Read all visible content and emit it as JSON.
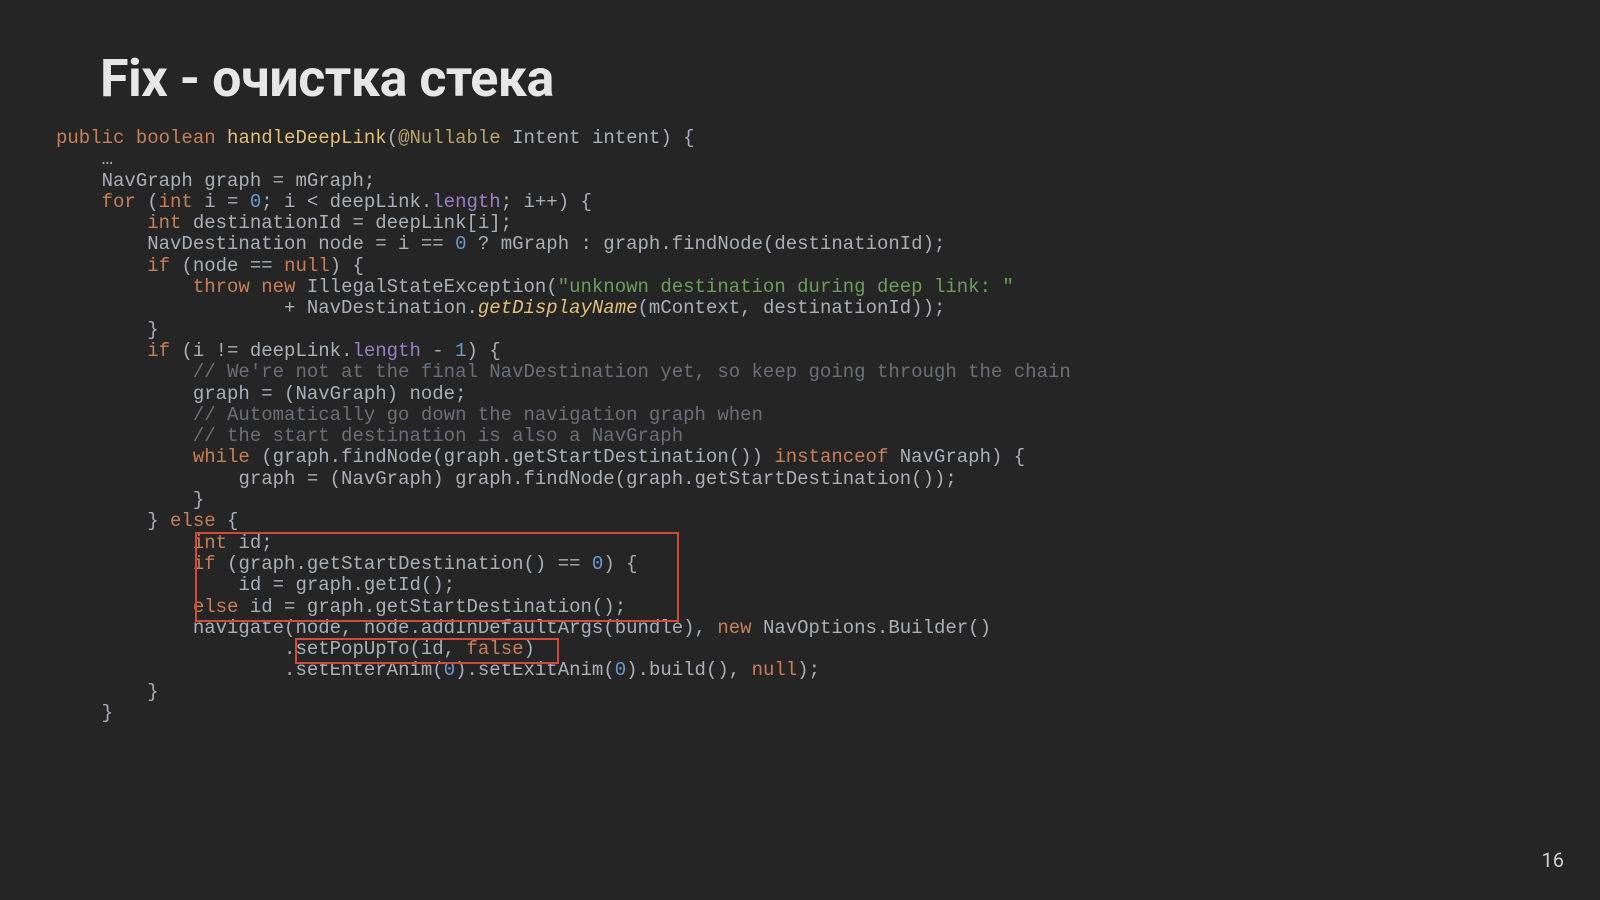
{
  "title": "Fix - очистка стека",
  "page_number": "16",
  "code": {
    "l0": {
      "indent": "",
      "a": "public ",
      "b": "boolean ",
      "c": "handleDeepLink",
      "d": "(",
      "e": "@Nullable ",
      "f": "Intent intent) {"
    },
    "l1": {
      "indent": "    ",
      "a": "…"
    },
    "l2": {
      "indent": "    ",
      "a": "NavGraph graph = mGraph;"
    },
    "l3": {
      "indent": "    ",
      "a": "for ",
      "b": "(",
      "c": "int ",
      "d": "i = ",
      "e": "0",
      "f": "; i < deepLink.",
      "g": "length",
      "h": "; i++) {"
    },
    "l4": {
      "indent": "        ",
      "a": "int ",
      "b": "destinationId = deepLink[i];"
    },
    "l5": {
      "indent": "        ",
      "a": "NavDestination node = i == ",
      "b": "0 ",
      "c": "? mGraph : graph.findNode(destinationId);"
    },
    "l6": {
      "indent": "        ",
      "a": "if ",
      "b": "(node == ",
      "c": "null",
      "d": ") {"
    },
    "l7": {
      "indent": "            ",
      "a": "throw new ",
      "b": "IllegalStateException(",
      "c": "\"unknown destination during deep link: \""
    },
    "l8": {
      "indent": "                    ",
      "a": "+ NavDestination.",
      "b": "getDisplayName",
      "c": "(mContext, destinationId));"
    },
    "l9": {
      "indent": "        ",
      "a": "}"
    },
    "l10": {
      "indent": "        ",
      "a": "if ",
      "b": "(i != deepLink.",
      "c": "length ",
      "d": "- ",
      "e": "1",
      "f": ") {"
    },
    "l11": {
      "indent": "            ",
      "a": "// We're not at the final NavDestination yet, so keep going through the chain"
    },
    "l12": {
      "indent": "            ",
      "a": "graph = (NavGraph) node;"
    },
    "l13": {
      "indent": "            ",
      "a": "// Automatically go down the navigation graph when"
    },
    "l14": {
      "indent": "            ",
      "a": "// the start destination is also a NavGraph"
    },
    "l15": {
      "indent": "            ",
      "a": "while ",
      "b": "(graph.findNode(graph.getStartDestination()) ",
      "c": "instanceof ",
      "d": "NavGraph) {"
    },
    "l16": {
      "indent": "                ",
      "a": "graph = (NavGraph) graph.findNode(graph.getStartDestination());"
    },
    "l17": {
      "indent": "            ",
      "a": "}"
    },
    "l18": {
      "indent": "        ",
      "a": "} ",
      "b": "else ",
      "c": "{"
    },
    "l19": {
      "indent": "            ",
      "a": "int ",
      "b": "id;"
    },
    "l20": {
      "indent": "            ",
      "a": "if ",
      "b": "(graph.getStartDestination() == ",
      "c": "0",
      "d": ") {"
    },
    "l21": {
      "indent": "                ",
      "a": "id = graph.getId();"
    },
    "l22": {
      "indent": "            ",
      "a": "else ",
      "b": "id = graph.getStartDestination();"
    },
    "l23": {
      "indent": "            ",
      "a": "navigate(node, node.addInDefaultArgs(bundle), ",
      "b": "new ",
      "c": "NavOptions.Builder()"
    },
    "l24": {
      "indent": "                    ",
      "a": ".setPopUpTo(id, ",
      "b": "false",
      "c": ")"
    },
    "l25": {
      "indent": "                    ",
      "a": ".setEnterAnim(",
      "b": "0",
      "c": ").setExitAnim(",
      "d": "0",
      "e": ").build(), ",
      "f": "null",
      "g": ");"
    },
    "l26": {
      "indent": "        ",
      "a": "}"
    },
    "l27": {
      "indent": "    ",
      "a": "}"
    }
  }
}
